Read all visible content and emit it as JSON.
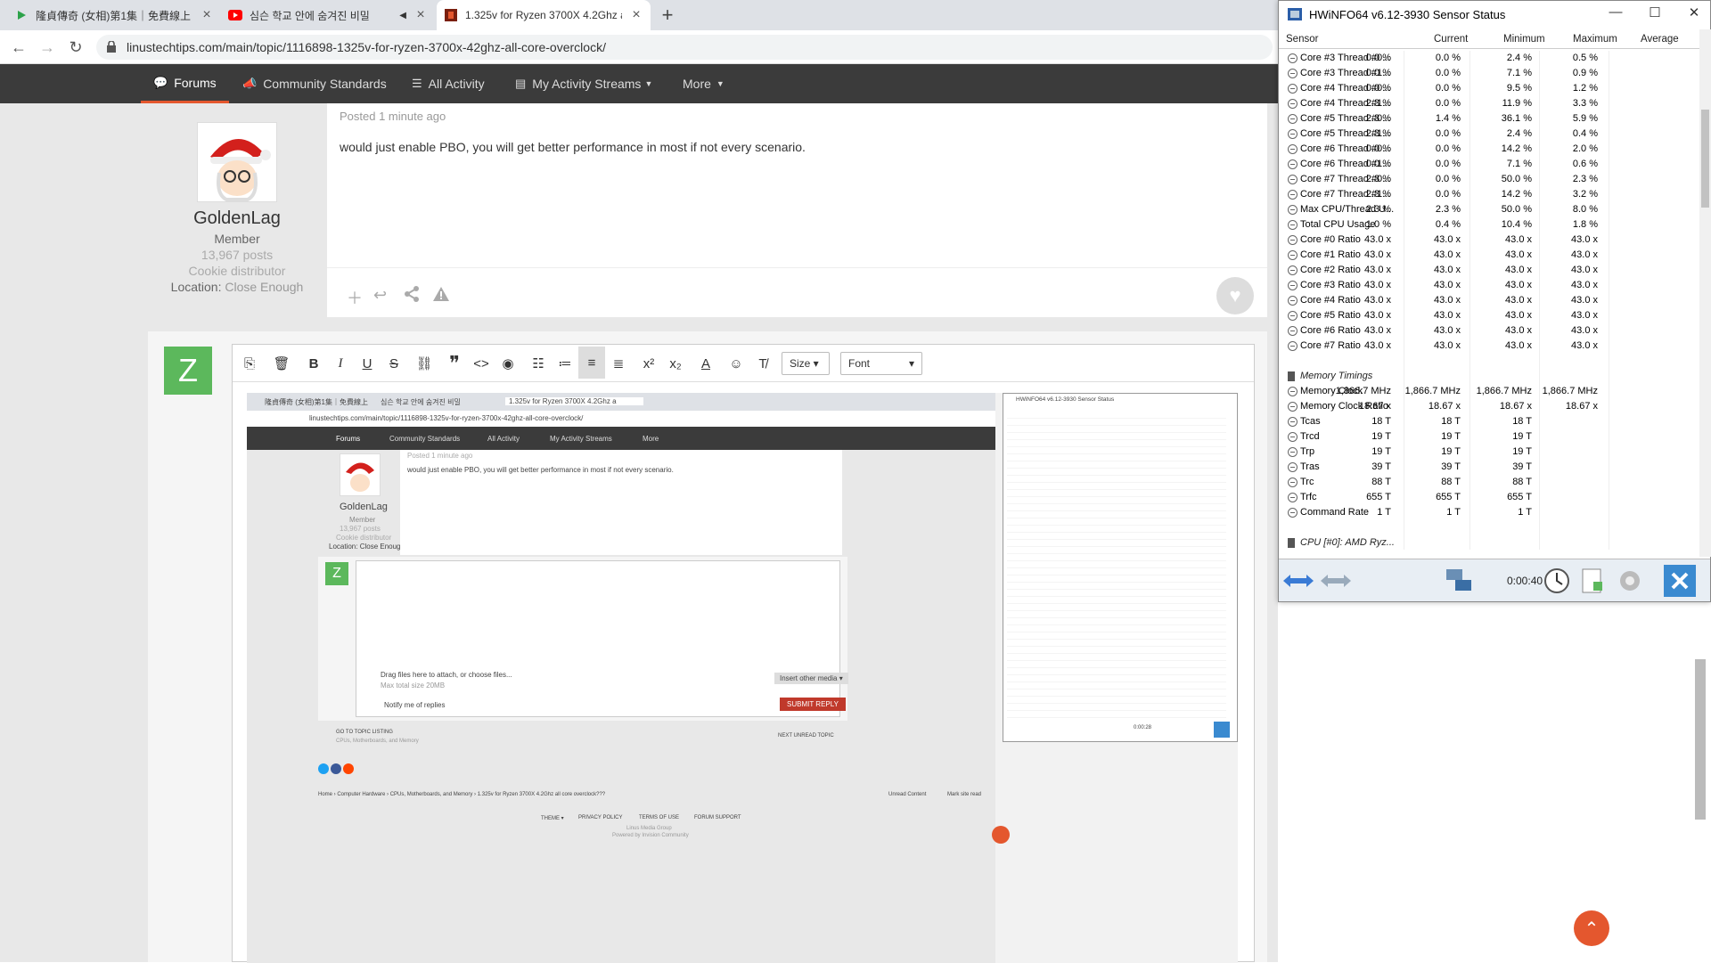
{
  "browser": {
    "tabs": [
      {
        "title": "隆貞傳奇 (女相)第1集｜免費線上",
        "favicon": "play"
      },
      {
        "title": "심슨 학교 안에 숨겨진 비밀",
        "favicon": "youtube",
        "audio": "◀"
      },
      {
        "title": "1.325v for Ryzen 3700X 4.2Ghz a",
        "favicon": "ltt"
      }
    ],
    "url": "linustechtips.com/main/topic/1116898-1325v-for-ryzen-3700x-42ghz-all-core-overclock/"
  },
  "sitenav": {
    "items": [
      "Forums",
      "Community Standards",
      "All Activity",
      "My Activity Streams",
      "More"
    ]
  },
  "post": {
    "posted": "Posted 1 minute ago",
    "text": "would just enable PBO, you will get better performance in most if not every scenario.",
    "author": {
      "name": "GoldenLag",
      "role": "Member",
      "posts": "13,967 posts",
      "title": "Cookie distributor",
      "location_label": "Location:",
      "location": "Close Enough"
    }
  },
  "reply": {
    "avatar_letter": "Z",
    "size_label": "Size",
    "font_label": "Font"
  },
  "mini": {
    "posted": "Posted 1 minute ago",
    "text": "would just enable PBO, you will get better performance in most if not every scenario.",
    "name": "GoldenLag",
    "role": "Member",
    "posts": "13,967 posts",
    "title": "Cookie distributor",
    "location": "Location: Close Enough",
    "drag": "Drag files here to attach, or choose files...",
    "maxsize": "Max total size 20MB",
    "insert": "Insert other media ▾",
    "notify": "Notify me of replies",
    "submit": "SUBMIT REPLY",
    "goto": "GO TO TOPIC LISTING",
    "goto_sub": "CPUs, Motherboards, and Memory",
    "next": "NEXT UNREAD TOPIC",
    "breadcrumb": "Home › Computer Hardware › CPUs, Motherboards, and Memory › 1.325v for Ryzen 3700X 4.2Ghz all core overclock???",
    "unread": "Unread Content",
    "markread": "Mark site read",
    "footer": [
      "THEME ▾",
      "PRIVACY POLICY",
      "TERMS OF USE",
      "FORUM SUPPORT"
    ],
    "company": "Linus Media Group",
    "powered": "Powered by Invision Community",
    "hw_title": "HWiNFO64 v6.12-3930 Sensor Status",
    "hw_time": "0:00:28"
  },
  "hwinfo": {
    "title": "HWiNFO64 v6.12-3930 Sensor Status",
    "columns": [
      "Sensor",
      "Current",
      "Minimum",
      "Maximum",
      "Average"
    ],
    "rows": [
      [
        "Core #3 Thread #0...",
        "0.0 %",
        "0.0 %",
        "2.4 %",
        "0.5 %"
      ],
      [
        "Core #3 Thread #1...",
        "0.0 %",
        "0.0 %",
        "7.1 %",
        "0.9 %"
      ],
      [
        "Core #4 Thread #0...",
        "0.0 %",
        "0.0 %",
        "9.5 %",
        "1.2 %"
      ],
      [
        "Core #4 Thread #1...",
        "2.3 %",
        "0.0 %",
        "11.9 %",
        "3.3 %"
      ],
      [
        "Core #5 Thread #0...",
        "2.3 %",
        "1.4 %",
        "36.1 %",
        "5.9 %"
      ],
      [
        "Core #5 Thread #1...",
        "2.3 %",
        "0.0 %",
        "2.4 %",
        "0.4 %"
      ],
      [
        "Core #6 Thread #0...",
        "0.0 %",
        "0.0 %",
        "14.2 %",
        "2.0 %"
      ],
      [
        "Core #6 Thread #1...",
        "0.0 %",
        "0.0 %",
        "7.1 %",
        "0.6 %"
      ],
      [
        "Core #7 Thread #0...",
        "2.3 %",
        "0.0 %",
        "50.0 %",
        "2.3 %"
      ],
      [
        "Core #7 Thread #1...",
        "2.3 %",
        "0.0 %",
        "14.2 %",
        "3.2 %"
      ],
      [
        "Max CPU/Thread U...",
        "2.3 %",
        "2.3 %",
        "50.0 %",
        "8.0 %"
      ],
      [
        "Total CPU Usage",
        "1.0 %",
        "0.4 %",
        "10.4 %",
        "1.8 %"
      ],
      [
        "Core #0 Ratio",
        "43.0 x",
        "43.0 x",
        "43.0 x",
        "43.0 x"
      ],
      [
        "Core #1 Ratio",
        "43.0 x",
        "43.0 x",
        "43.0 x",
        "43.0 x"
      ],
      [
        "Core #2 Ratio",
        "43.0 x",
        "43.0 x",
        "43.0 x",
        "43.0 x"
      ],
      [
        "Core #3 Ratio",
        "43.0 x",
        "43.0 x",
        "43.0 x",
        "43.0 x"
      ],
      [
        "Core #4 Ratio",
        "43.0 x",
        "43.0 x",
        "43.0 x",
        "43.0 x"
      ],
      [
        "Core #5 Ratio",
        "43.0 x",
        "43.0 x",
        "43.0 x",
        "43.0 x"
      ],
      [
        "Core #6 Ratio",
        "43.0 x",
        "43.0 x",
        "43.0 x",
        "43.0 x"
      ],
      [
        "Core #7 Ratio",
        "43.0 x",
        "43.0 x",
        "43.0 x",
        "43.0 x"
      ]
    ],
    "group1": "Memory Timings",
    "rows2": [
      [
        "Memory Clock",
        "1,866.7 MHz",
        "1,866.7 MHz",
        "1,866.7 MHz",
        "1,866.7 MHz"
      ],
      [
        "Memory Clock Ratio",
        "18.67 x",
        "18.67 x",
        "18.67 x",
        "18.67 x"
      ],
      [
        "Tcas",
        "18 T",
        "18 T",
        "18 T",
        ""
      ],
      [
        "Trcd",
        "19 T",
        "19 T",
        "19 T",
        ""
      ],
      [
        "Trp",
        "19 T",
        "19 T",
        "19 T",
        ""
      ],
      [
        "Tras",
        "39 T",
        "39 T",
        "39 T",
        ""
      ],
      [
        "Trc",
        "88 T",
        "88 T",
        "88 T",
        ""
      ],
      [
        "Trfc",
        "655 T",
        "655 T",
        "655 T",
        ""
      ],
      [
        "Command Rate",
        "1 T",
        "1 T",
        "1 T",
        ""
      ]
    ],
    "group2": "CPU [#0]: AMD Ryz...",
    "time": "0:00:40"
  },
  "colors": {
    "accent": "#e4572e",
    "navbar": "#3b3b3b",
    "avatar_green": "#5cb85c"
  }
}
